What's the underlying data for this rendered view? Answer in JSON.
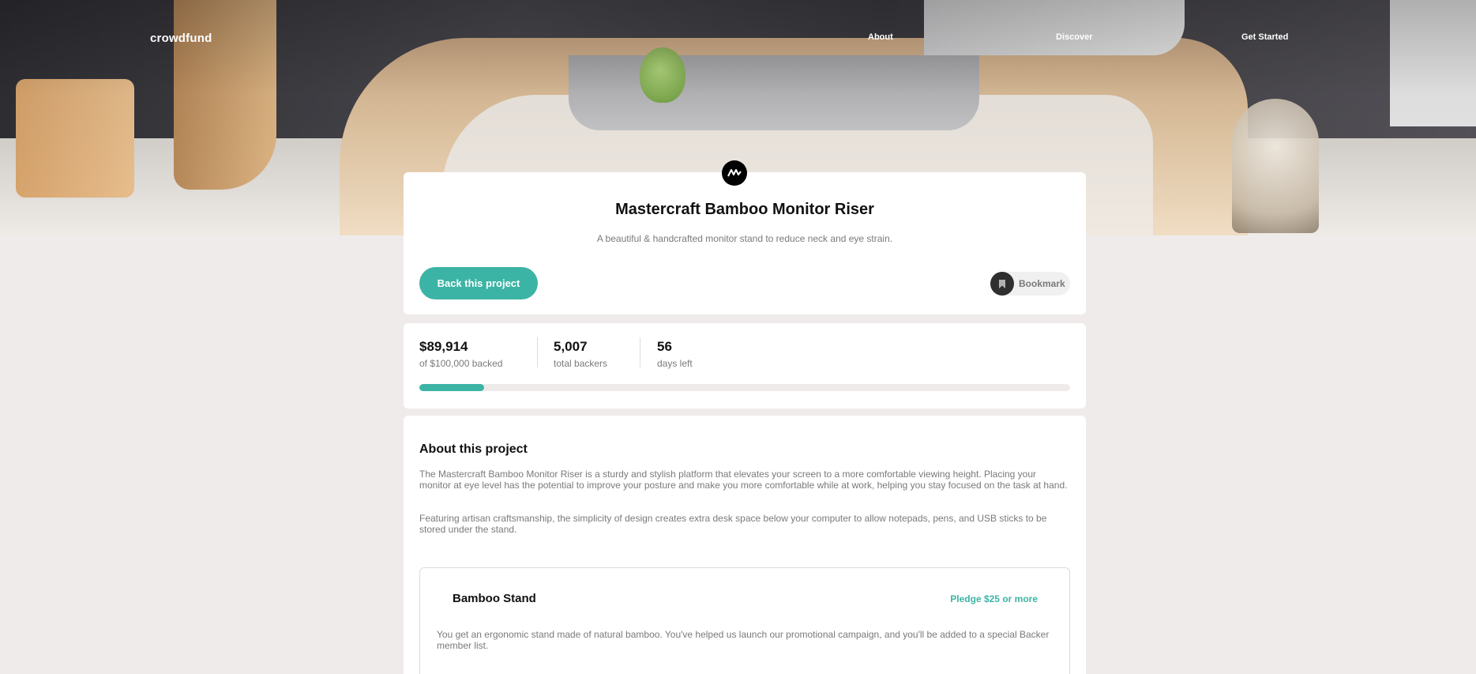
{
  "nav": {
    "logo": "crowdfund",
    "links": [
      "About",
      "Discover",
      "Get Started"
    ]
  },
  "project": {
    "title": "Mastercraft Bamboo Monitor Riser",
    "subtitle": "A beautiful & handcrafted monitor stand to reduce neck and eye strain.",
    "back_button": "Back this project",
    "bookmark_label": "Bookmark"
  },
  "stats": {
    "backed_amount": "$89,914",
    "backed_label": "of $100,000 backed",
    "backers": "5,007",
    "backers_label": "total backers",
    "days": "56",
    "days_label": "days left",
    "progress_fraction": 0.1
  },
  "about": {
    "title": "About this project",
    "paragraphs": [
      "The Mastercraft Bamboo Monitor Riser is a sturdy and stylish platform that elevates your screen to a more comfortable viewing height. Placing your monitor at eye level has the potential to improve your posture and make you more comfortable while at work, helping you stay focused on the task at hand.",
      "Featuring artisan craftsmanship, the simplicity of design creates extra desk space below your computer to allow notepads, pens, and USB sticks to be stored under the stand."
    ]
  },
  "rewards": [
    {
      "title": "Bamboo Stand",
      "pledge": "Pledge $25 or more",
      "description": "You get an ergonomic stand made of natural bamboo. You've helped us launch our promotional campaign, and you'll be added to a special Backer member list."
    }
  ],
  "colors": {
    "accent": "#3cb4a5",
    "background": "#efebea"
  },
  "icons": {
    "logo_mark": "mastercraft-logo-icon",
    "bookmark": "bookmark-icon"
  }
}
